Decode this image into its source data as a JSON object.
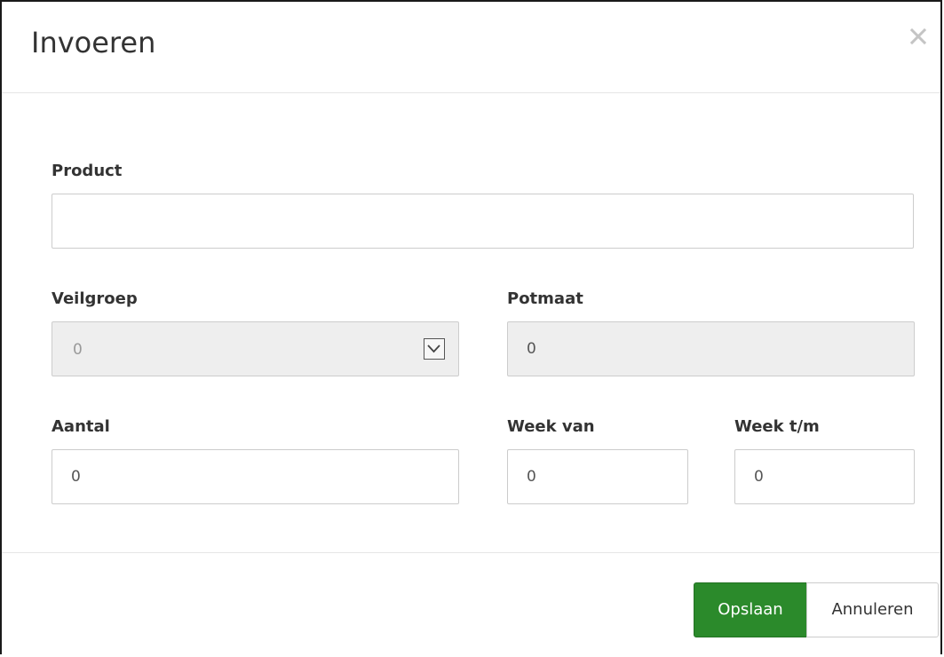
{
  "dialog": {
    "title": "Invoeren",
    "close_icon": "close-icon"
  },
  "form": {
    "product": {
      "label": "Product",
      "value": ""
    },
    "veilgroep": {
      "label": "Veilgroep",
      "selected": "0",
      "disabled": true
    },
    "potmaat": {
      "label": "Potmaat",
      "value": "0",
      "disabled": true
    },
    "aantal": {
      "label": "Aantal",
      "value": "0"
    },
    "week_van": {
      "label": "Week van",
      "value": "0"
    },
    "week_tm": {
      "label": "Week t/m",
      "value": "0"
    }
  },
  "footer": {
    "save_label": "Opslaan",
    "cancel_label": "Annuleren"
  },
  "colors": {
    "save_button": "#2b8a2b",
    "disabled_field": "#eeeeee",
    "border": "#cccccc"
  }
}
